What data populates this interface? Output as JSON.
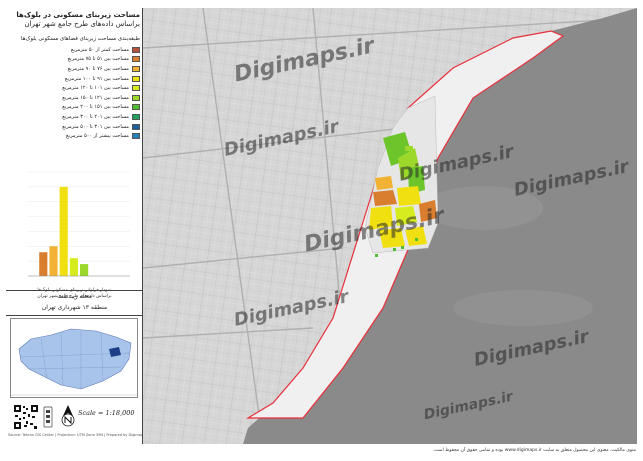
{
  "panel": {
    "title_line1": "مساحت زیربنای مسکونی در بلوک‌ها",
    "title_line2": "براساس داده‌های طرح جامع شهر تهران",
    "legend_heading": "طبقه‌بندی مساحت زیربنای فضاهای مسکونی بلوک‌ها",
    "legend": [
      {
        "label": "مساحت کمتر از ۵۰ مترمربع",
        "color": "#b5533c"
      },
      {
        "label": "مساحت بین ۵۱ تا ۷۵ مترمربع",
        "color": "#d97d2e"
      },
      {
        "label": "مساحت بین ۷۶ تا ۹۰ مترمربع",
        "color": "#f2b233"
      },
      {
        "label": "مساحت بین ۹۱ تا ۱۰۰ مترمربع",
        "color": "#f0e012"
      },
      {
        "label": "مساحت بین ۱۰۱ تا ۱۲۰ مترمربع",
        "color": "#d7ec1f"
      },
      {
        "label": "مساحت بین ۱۲۱ تا ۱۵۰ مترمربع",
        "color": "#9bd82a"
      },
      {
        "label": "مساحت بین ۱۵۱ تا ۲۰۰ مترمربع",
        "color": "#4fbf30"
      },
      {
        "label": "مساحت بین ۲۰۱ تا ۳۰۰ مترمربع",
        "color": "#23a05a"
      },
      {
        "label": "مساحت بین ۳۰۱ تا ۵۰۰ مترمربع",
        "color": "#1e5fa0"
      },
      {
        "label": "مساحت بیشتر از ۵۰۰ مترمربع",
        "color": "#2a7fb8"
      }
    ],
    "histogram_caption_line1": "نمودار فراوانی زیربنای مسکونی بلوک‌ها",
    "histogram_caption_line2": "براساس داده‌های طرح جامع شهر تهران",
    "region_name": "محله زیبدشت",
    "region_sub": "منطقه ۱۳ شهرداری تهران",
    "scale": "Scale = 1:18,000",
    "credits": "Source: Tehran GIS Center | Projection: UTM Zone 39N | Prepared by Digimaps"
  },
  "chart_data": {
    "type": "bar",
    "categories": [
      "<50",
      "51-75",
      "76-90",
      "91-100",
      "101-120",
      "121-150",
      "151-200",
      "201-300",
      "301-500",
      ">500"
    ],
    "values": [
      0,
      8,
      10,
      30,
      6,
      4,
      0,
      0,
      0,
      0
    ],
    "colors": [
      "#b5533c",
      "#d97d2e",
      "#f2b233",
      "#f0e012",
      "#d7ec1f",
      "#9bd82a",
      "#4fbf30",
      "#23a05a",
      "#1e5fa0",
      "#2a7fb8"
    ],
    "ylim": [
      0,
      35
    ],
    "grid": true
  },
  "map": {
    "watermark": "Digimaps.ir",
    "watermark_short": "Digimaps.ir",
    "land_color": "#d8d8d8",
    "water_color": "#8a8a8a",
    "boundary_color": "#e8303a"
  },
  "footer": "منوی مالکیت، معنوی این محصول متعلق به سایت www.digimaps.ir بوده و تمامی حقوق آن محفوظ است."
}
